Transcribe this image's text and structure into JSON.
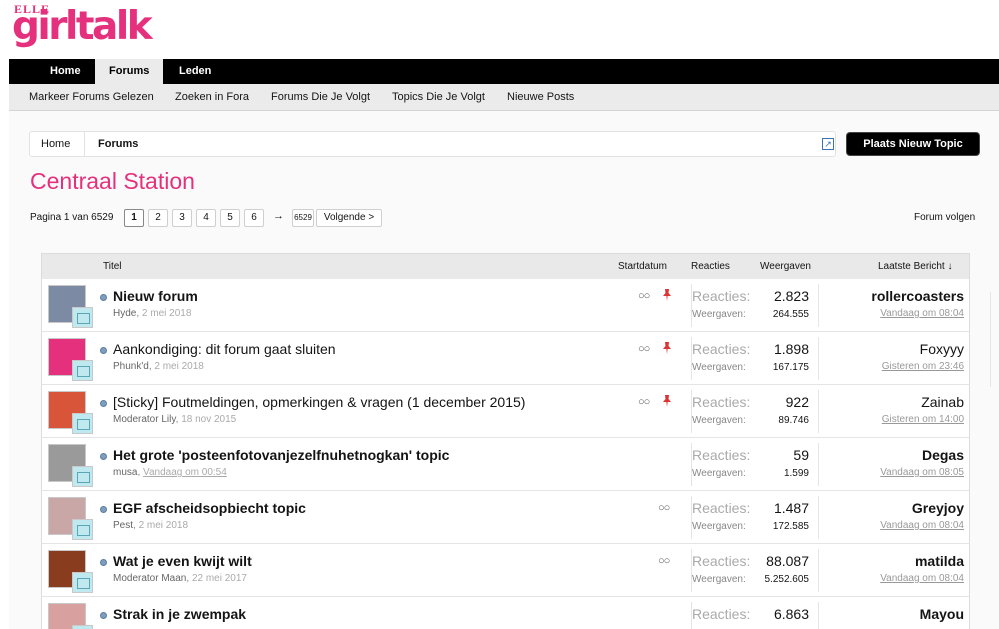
{
  "brand": {
    "elle": "ELLE",
    "name": "girltalk",
    "accent": "#e5317d"
  },
  "nav": {
    "tabs": [
      "Home",
      "Forums",
      "Leden"
    ],
    "active": "Forums"
  },
  "subnav": [
    "Markeer Forums Gelezen",
    "Zoeken in Fora",
    "Forums Die Je Volgt",
    "Topics Die Je Volgt",
    "Nieuwe Posts"
  ],
  "breadcrumb": [
    "Home",
    "Forums"
  ],
  "new_topic_label": "Plaats Nieuw Topic",
  "page_title": "Centraal Station",
  "pagination": {
    "label": "Pagina 1 van 6529",
    "pages": [
      "1",
      "2",
      "3",
      "4",
      "5",
      "6"
    ],
    "arrow": "→",
    "last": "6529",
    "next": "Volgende >"
  },
  "follow_label": "Forum volgen",
  "headers": {
    "title": "Titel",
    "start": "Startdatum",
    "replies": "Reacties",
    "views": "Weergaven",
    "last": "Laatste Bericht ↓"
  },
  "rows": [
    {
      "title": "Nieuw forum",
      "bold": true,
      "author": "Hyde",
      "date": "2 mei 2018",
      "glasses": true,
      "pin": true,
      "replies": "2.823",
      "views": "264.555",
      "last_user": "rollercoasters",
      "last_bold": true,
      "last_date": "Vandaag om 08:04",
      "avatar": "#7d8aa3"
    },
    {
      "title": "Aankondiging: dit forum gaat sluiten",
      "bold": false,
      "author": "Phunk'd",
      "date": "2 mei 2018",
      "glasses": true,
      "pin": true,
      "replies": "1.898",
      "views": "167.175",
      "last_user": "Foxyyy",
      "last_bold": false,
      "last_date": "Gisteren om 23:46",
      "avatar": "#e5317d"
    },
    {
      "title": "[Sticky] Foutmeldingen, opmerkingen & vragen (1 december 2015)",
      "bold": false,
      "author": "Moderator Lily",
      "date": "18 nov 2015",
      "glasses": true,
      "pin": true,
      "replies": "922",
      "views": "89.746",
      "last_user": "Zainab",
      "last_bold": false,
      "last_date": "Gisteren om 14:00",
      "avatar": "#d9553a"
    },
    {
      "title": "Het grote 'posteenfotovanjezelfnuhetnogkan' topic",
      "bold": true,
      "author": "musa",
      "date": "Vandaag om 00:54",
      "glasses": false,
      "pin": false,
      "replies": "59",
      "views": "1.599",
      "last_user": "Degas",
      "last_bold": true,
      "last_date": "Vandaag om 08:05",
      "avatar": "#9a9a9a"
    },
    {
      "title": "EGF afscheidsopbiecht topic",
      "bold": true,
      "author": "Pest",
      "date": "2 mei 2018",
      "glasses": true,
      "pin": false,
      "replies": "1.487",
      "views": "172.585",
      "last_user": "Greyjoy",
      "last_bold": true,
      "last_date": "Vandaag om 08:04",
      "avatar": "#c9a7a7"
    },
    {
      "title": "Wat je even kwijt wilt",
      "bold": true,
      "author": "Moderator Maan",
      "date": "22 mei 2017",
      "glasses": true,
      "pin": false,
      "replies": "88.087",
      "views": "5.252.605",
      "last_user": "matilda",
      "last_bold": true,
      "last_date": "Vandaag om 08:04",
      "avatar": "#8a3d1e"
    },
    {
      "title": "Strak in je zwempak",
      "bold": true,
      "author": "",
      "date": "",
      "glasses": false,
      "pin": false,
      "replies": "6.863",
      "views": "",
      "last_user": "Mayou",
      "last_bold": true,
      "last_date": "",
      "avatar": "#d9a0a0"
    }
  ],
  "labels": {
    "replies": "Reacties:",
    "views": "Weergaven:",
    "glasses": "👓"
  }
}
